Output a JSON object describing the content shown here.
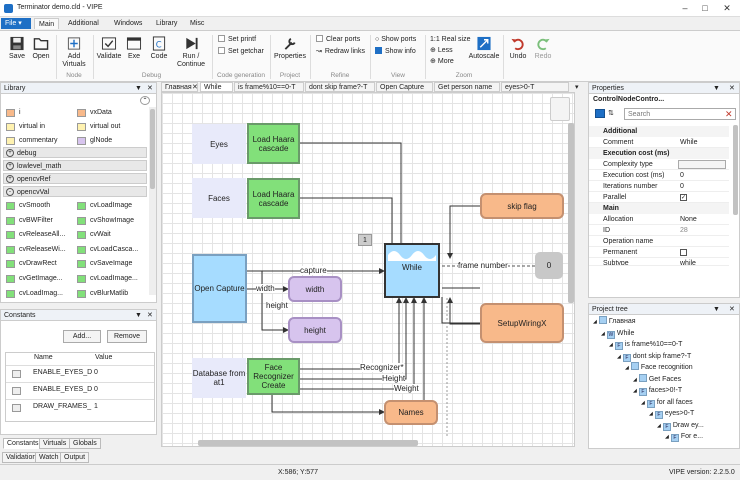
{
  "window": {
    "title": "Terminator demo.cld - VIPE"
  },
  "menu": {
    "file": "File",
    "tabs": [
      "Main",
      "Additional",
      "Windows",
      "Library",
      "Misc"
    ]
  },
  "ribbon": {
    "save": "Save",
    "open": "Open",
    "add_virtuals": "Add Virtuals",
    "validate": "Validate",
    "exe": "Exe",
    "code": "Code",
    "run": "Run / Continue",
    "set_printf": "Set printf",
    "set_getchar": "Set getchar",
    "properties": "Properties",
    "clear_ports": "Clear ports",
    "redraw_links": "Redraw links",
    "show_ports": "Show ports",
    "show_info": "Show info",
    "real_size": "1:1 Real size",
    "less": "Less",
    "more": "More",
    "autoscale": "Autoscale",
    "undo": "Undo",
    "redo": "Redo",
    "groups": {
      "node": "Node",
      "debug": "Debug",
      "codegen": "Code generation",
      "project": "Project",
      "refine": "Refine",
      "view": "View",
      "zoom": "Zoom"
    }
  },
  "library": {
    "title": "Library",
    "top_items": [
      {
        "label": "i",
        "color": "#f8b98a"
      },
      {
        "label": "vxData",
        "color": "#f8b98a"
      },
      {
        "label": "virtual in",
        "color": "#fff2b0"
      },
      {
        "label": "virtual out",
        "color": "#fff2b0"
      },
      {
        "label": "commentary",
        "color": "#fff2b0"
      },
      {
        "label": "glNode",
        "color": "#d7c4ee"
      }
    ],
    "categories": [
      {
        "label": "debug",
        "state": "+"
      },
      {
        "label": "lowlevel_math",
        "state": "+"
      },
      {
        "label": "opencvRef",
        "state": "+"
      },
      {
        "label": "opencvVal",
        "state": "-"
      }
    ],
    "cv_items": [
      "cvSmooth",
      "cvLoadImage",
      "cvBWFilter",
      "cvShowImage",
      "cvReleaseAll...",
      "cvWait",
      "cvReleaseWi...",
      "cvLoadCasca...",
      "cvDrawRect",
      "cvSaveImage",
      "cvGetImage...",
      "cvLoadImage...",
      "cvLoadImag...",
      "cvBlurMatlib"
    ]
  },
  "constants": {
    "title": "Constants",
    "add": "Add...",
    "remove": "Remove",
    "col_name": "Name",
    "col_value": "Value",
    "rows": [
      {
        "name": "ENABLE_EYES_D",
        "value": "0"
      },
      {
        "name": "ENABLE_EYES_D",
        "value": "0"
      },
      {
        "name": "DRAW_FRAMES_",
        "value": "1"
      }
    ],
    "tabs": [
      "Constants",
      "Virtuals",
      "Globals"
    ],
    "bottom_tabs": [
      "Validation",
      "Watch",
      "Output"
    ]
  },
  "doc_tabs": [
    "Главная",
    "While",
    "is frame%10==0-T",
    "dont skip frame?-T",
    "Open Capture",
    "Get person name",
    "eyes>0-T"
  ],
  "diagram": {
    "eyes": "Eyes",
    "faces": "Faces",
    "load_haar_1": "Load Haara cascade",
    "load_haar_2": "Load Haara cascade",
    "open_capture": "Open Capture",
    "database": "Database from at1",
    "face_recognizer": "Face Recognizer Create",
    "while": "While",
    "skip_flag": "skip flag",
    "setup": "SetupWiringX",
    "width": "width",
    "height": "height",
    "names": "Names",
    "zero": "0",
    "index_badge": "1",
    "link_capture": "capture",
    "link_width": "width",
    "link_height": "height",
    "link_frame": "frame number",
    "link_recognizer": "Recognizer*",
    "link_rheight": "Height",
    "link_weight": "Weight"
  },
  "properties": {
    "title": "Properties",
    "node_name": "ControlNodeContro...",
    "search_placeholder": "Search",
    "sections": {
      "additional": "Additional",
      "exec": "Execution cost (ms)",
      "main": "Main"
    },
    "rows": {
      "comment_k": "Comment",
      "comment_v": "While",
      "complexity_k": "Complexity type",
      "exec_k": "Execution cost (ms)",
      "exec_v": "0",
      "iter_k": "Iterations number",
      "iter_v": "0",
      "parallel_k": "Parallel",
      "alloc_k": "Allocation",
      "alloc_v": "None",
      "id_k": "ID",
      "id_v": "28",
      "opname_k": "Operation name",
      "perm_k": "Permanent",
      "subtype_k": "Subtype",
      "subtype_v": "while"
    }
  },
  "project_tree": {
    "title": "Project tree",
    "nodes": [
      {
        "label": "Главная",
        "icon": "",
        "level": 0
      },
      {
        "label": "While",
        "icon": "W",
        "level": 1
      },
      {
        "label": "is frame%10==0-T",
        "icon": "F",
        "level": 2
      },
      {
        "label": "dont skip frame?-T",
        "icon": "F",
        "level": 3
      },
      {
        "label": "Face  recognition",
        "icon": "",
        "level": 4
      },
      {
        "label": "Get Faces",
        "icon": "",
        "level": 5
      },
      {
        "label": "faces>0!-T",
        "icon": "F",
        "level": 5
      },
      {
        "label": "for all faces",
        "icon": "F",
        "level": 6
      },
      {
        "label": "eyes>0-T",
        "icon": "F",
        "level": 7
      },
      {
        "label": "Draw ey...",
        "icon": "F",
        "level": 8
      },
      {
        "label": "For e...",
        "icon": "F",
        "level": 9
      }
    ]
  },
  "status": {
    "coords": "X:586; Y:577",
    "version": "VIPE version: 2.2.5.0"
  },
  "colors": {
    "accent": "#1e6fc5",
    "green_node": "#82e07a",
    "blue_node": "#a6dcff",
    "orange_node": "#f8b98a",
    "purple_node": "#d7c4ee"
  }
}
